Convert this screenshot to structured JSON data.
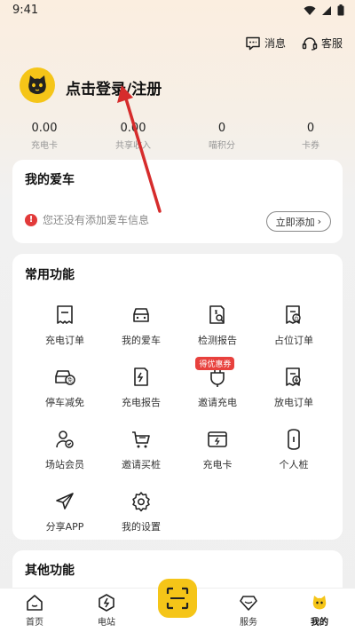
{
  "status_bar": {
    "time": "9:41"
  },
  "header": {
    "messages_label": "消息",
    "service_label": "客服",
    "login_text": "点击登录/注册"
  },
  "stats": [
    {
      "value": "0.00",
      "label": "充电卡"
    },
    {
      "value": "0.00",
      "label": "共享收入"
    },
    {
      "value": "0",
      "label": "喵积分"
    },
    {
      "value": "0",
      "label": "卡券"
    }
  ],
  "my_car": {
    "title": "我的爱车",
    "empty_text": "您还没有添加爱车信息",
    "add_button": "立即添加"
  },
  "functions": {
    "title": "常用功能",
    "promo_badge": "得优惠券",
    "items": [
      {
        "label": "充电订单",
        "icon": "order-icon"
      },
      {
        "label": "我的爱车",
        "icon": "car-icon"
      },
      {
        "label": "检测报告",
        "icon": "report-search-icon"
      },
      {
        "label": "占位订单",
        "icon": "parking-order-icon"
      },
      {
        "label": "停车减免",
        "icon": "parking-discount-icon"
      },
      {
        "label": "充电报告",
        "icon": "charge-report-icon"
      },
      {
        "label": "邀请充电",
        "icon": "plug-icon"
      },
      {
        "label": "放电订单",
        "icon": "discharge-order-icon"
      },
      {
        "label": "场站会员",
        "icon": "member-icon"
      },
      {
        "label": "邀请买桩",
        "icon": "cart-icon"
      },
      {
        "label": "充电卡",
        "icon": "card-icon"
      },
      {
        "label": "个人桩",
        "icon": "charger-icon"
      },
      {
        "label": "分享APP",
        "icon": "share-icon"
      },
      {
        "label": "我的设置",
        "icon": "settings-icon"
      }
    ]
  },
  "other": {
    "title": "其他功能"
  },
  "bottom_nav": {
    "home": "首页",
    "station": "电站",
    "service": "服务",
    "mine": "我的"
  },
  "colors": {
    "accent": "#f5c518",
    "warning": "#e23a3a",
    "arrow": "#d62c2c"
  }
}
